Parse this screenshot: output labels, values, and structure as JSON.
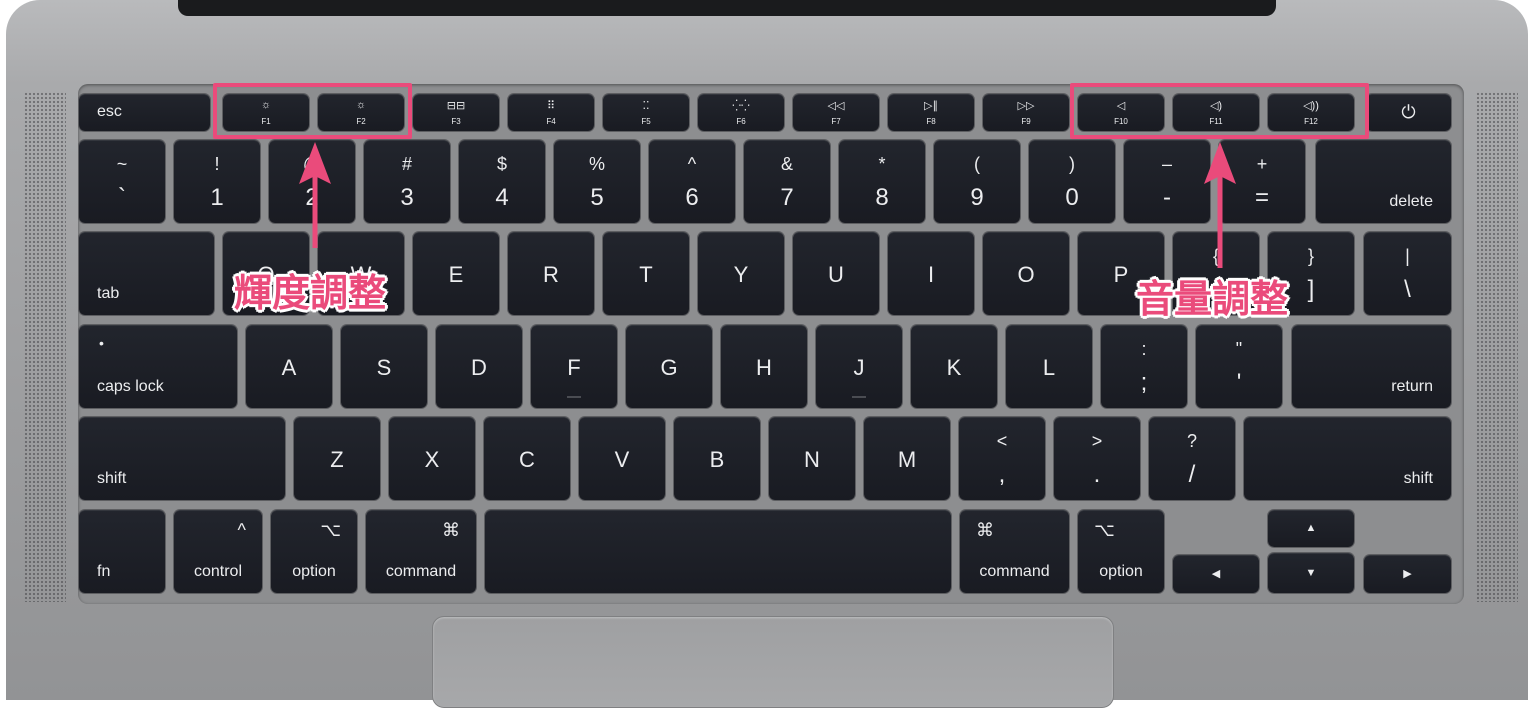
{
  "colors": {
    "annotation": "#ea4b7b",
    "key": "#1d1f26",
    "key_text": "#ecedef",
    "chassis": "#9c9d9f"
  },
  "fn_row": {
    "esc": "esc",
    "f1": "F1",
    "f2": "F2",
    "f3": "F3",
    "f4": "F4",
    "f5": "F5",
    "f6": "F6",
    "f7": "F7",
    "f8": "F8",
    "f9": "F9",
    "f10": "F10",
    "f11": "F11",
    "f12": "F12",
    "icons": {
      "f1": "☼",
      "f2": "☼",
      "f3": "⊟⊟",
      "f4": "⠿",
      "f5": "⁚⁚",
      "f6": "⁛⁛",
      "f7": "◁◁",
      "f8": "▷∥",
      "f9": "▷▷",
      "f10": "◁",
      "f11": "◁)",
      "f12": "◁))",
      "power": "⏻"
    }
  },
  "number_row": {
    "tilde": {
      "top": "~",
      "bottom": "`"
    },
    "n1": {
      "top": "!",
      "bottom": "1"
    },
    "n2": {
      "top": "@",
      "bottom": "2"
    },
    "n3": {
      "top": "#",
      "bottom": "3"
    },
    "n4": {
      "top": "$",
      "bottom": "4"
    },
    "n5": {
      "top": "%",
      "bottom": "5"
    },
    "n6": {
      "top": "^",
      "bottom": "6"
    },
    "n7": {
      "top": "&",
      "bottom": "7"
    },
    "n8": {
      "top": "*",
      "bottom": "8"
    },
    "n9": {
      "top": "(",
      "bottom": "9"
    },
    "n0": {
      "top": ")",
      "bottom": "0"
    },
    "minus": {
      "top": "–",
      "bottom": "-"
    },
    "equals": {
      "top": "+",
      "bottom": "="
    },
    "delete": "delete"
  },
  "top_row": {
    "tab": "tab",
    "q": "Q",
    "w": "W",
    "e": "E",
    "r": "R",
    "t": "T",
    "y": "Y",
    "u": "U",
    "i": "I",
    "o": "O",
    "p": "P",
    "lbracket": {
      "top": "{",
      "bottom": "["
    },
    "rbracket": {
      "top": "}",
      "bottom": "]"
    },
    "backslash": {
      "top": "|",
      "bottom": "\\"
    }
  },
  "home_row": {
    "caps_dot": "•",
    "caps": "caps lock",
    "a": "A",
    "s": "S",
    "d": "D",
    "f": "F",
    "g": "G",
    "h": "H",
    "j": "J",
    "k": "K",
    "l": "L",
    "semicolon": {
      "top": ":",
      "bottom": ";"
    },
    "quote": {
      "top": "\"",
      "bottom": "'"
    },
    "return": "return"
  },
  "bottom_row": {
    "shift": "shift",
    "z": "Z",
    "x": "X",
    "c": "C",
    "v": "V",
    "b": "B",
    "n": "N",
    "m": "M",
    "comma": {
      "top": "<",
      "bottom": ","
    },
    "period": {
      "top": ">",
      "bottom": "."
    },
    "slash": {
      "top": "?",
      "bottom": "/"
    }
  },
  "modifier_row": {
    "fn": "fn",
    "control": "control",
    "control_symbol": "^",
    "option": "option",
    "option_symbol": "⌥",
    "command": "command",
    "command_symbol": "⌘",
    "arrows": {
      "left": "◀",
      "right": "▶",
      "up": "▲",
      "down": "▼"
    }
  },
  "annotations": {
    "brightness": "輝度調整",
    "volume": "音量調整"
  }
}
